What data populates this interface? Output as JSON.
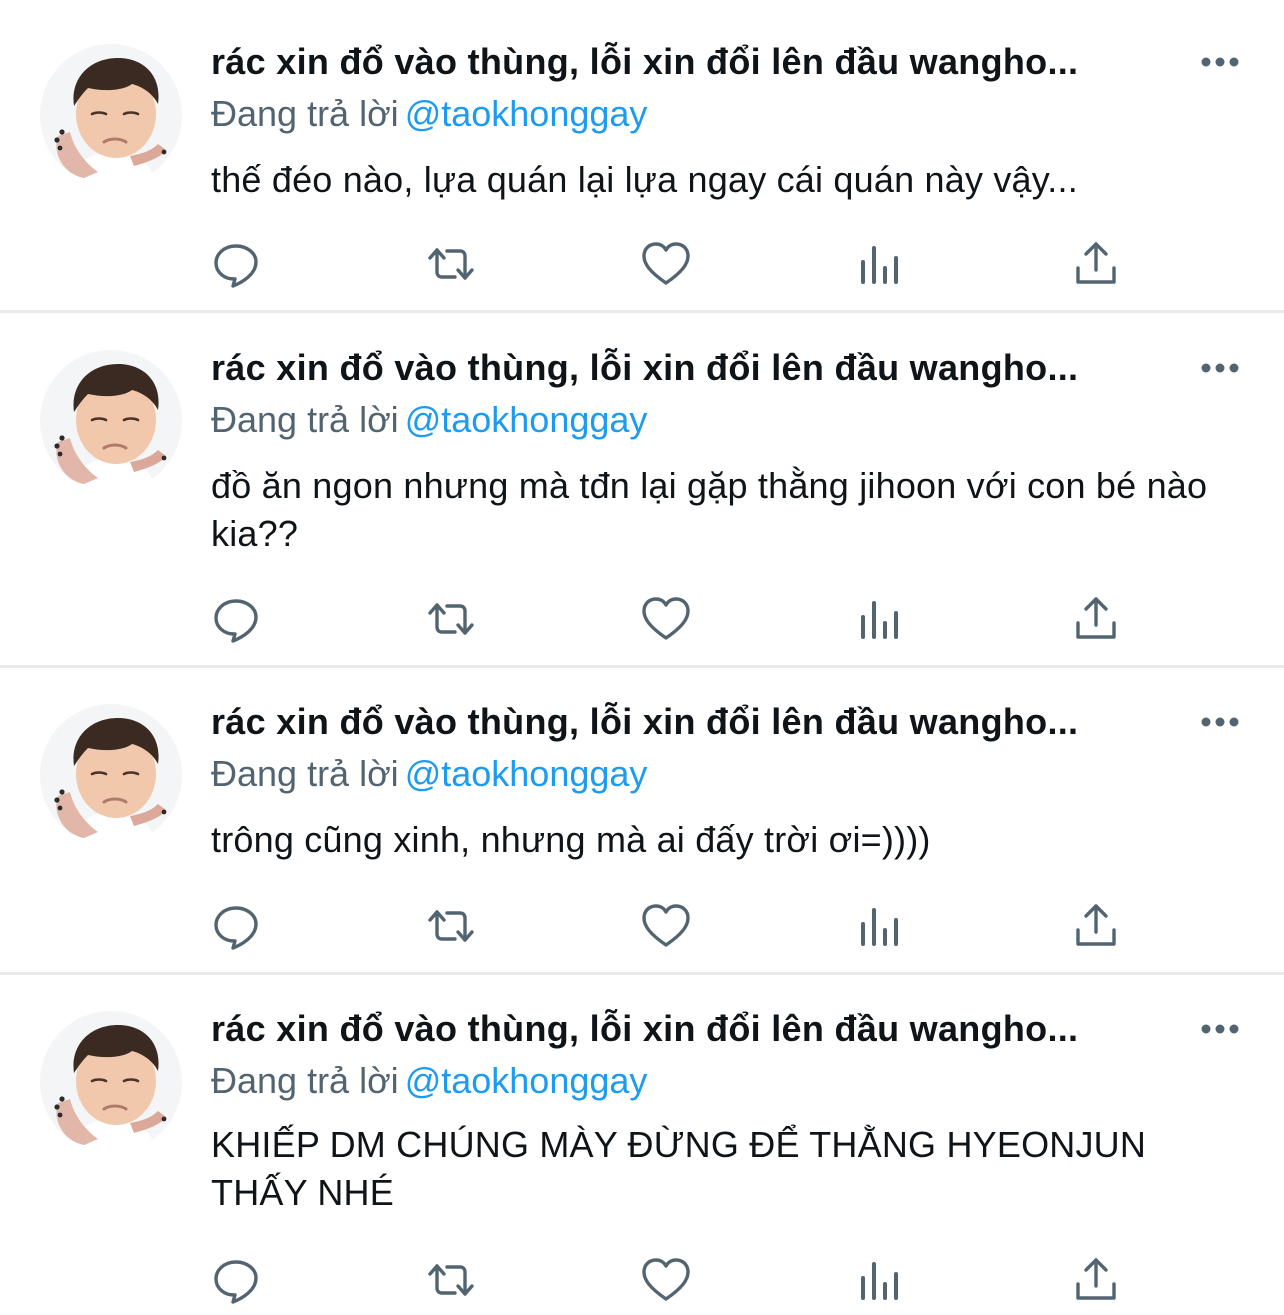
{
  "tweets": [
    {
      "display_name": "rác xin đổ vào thùng, lỗi xin đổi lên đầu wangho...",
      "reply_prefix": "Đang trả lời",
      "reply_handle": "@taokhonggay",
      "text": "thế đéo nào, lựa quán lại lựa ngay cái quán này vậy..."
    },
    {
      "display_name": "rác xin đổ vào thùng, lỗi xin đổi lên đầu wangho...",
      "reply_prefix": "Đang trả lời",
      "reply_handle": "@taokhonggay",
      "text": "đồ ăn ngon nhưng mà tđn lại gặp thằng jihoon với con bé nào kia??"
    },
    {
      "display_name": "rác xin đổ vào thùng, lỗi xin đổi lên đầu wangho...",
      "reply_prefix": "Đang trả lời",
      "reply_handle": "@taokhonggay",
      "text": "trông cũng xinh, nhưng mà ai đấy trời ơi=))))"
    },
    {
      "display_name": "rác xin đổ vào thùng, lỗi xin đổi lên đầu wangho...",
      "reply_prefix": "Đang trả lời",
      "reply_handle": "@taokhonggay",
      "text": "KHIẾP DM CHÚNG MÀY ĐỪNG ĐỂ THẰNG HYEONJUN THẤY NHÉ"
    }
  ],
  "icons": {
    "more": "more-dots-icon",
    "reply": "reply-icon",
    "retweet": "retweet-icon",
    "like": "heart-icon",
    "views": "views-chart-icon",
    "share": "share-icon"
  },
  "colors": {
    "text": "#0f1419",
    "secondary": "#536471",
    "link": "#1d9bf0",
    "divider": "#e7e9ea"
  }
}
